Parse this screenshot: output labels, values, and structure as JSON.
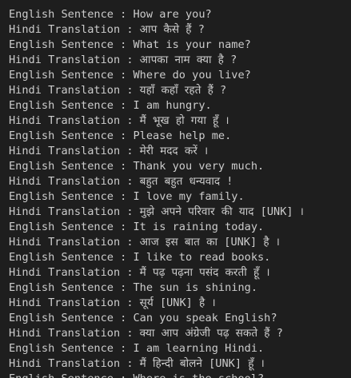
{
  "output": {
    "lines": [
      "English Sentence : How are you?",
      "Hindi Translation : आप कैसे हैं ?",
      "English Sentence : What is your name?",
      "Hindi Translation : आपका नाम क्या है ?",
      "English Sentence : Where do you live?",
      "Hindi Translation : यहाँ कहाँ रहते हैं ?",
      "English Sentence : I am hungry.",
      "Hindi Translation : मैं भूख हो गया हूँ ।",
      "English Sentence : Please help me.",
      "Hindi Translation : मेरी मदद करें ।",
      "English Sentence : Thank you very much.",
      "Hindi Translation : बहुत बहुत धन्यवाद !",
      "English Sentence : I love my family.",
      "Hindi Translation : मुझे अपने परिवार की याद [UNK] ।",
      "English Sentence : It is raining today.",
      "Hindi Translation : आज इस बात का [UNK] है ।",
      "English Sentence : I like to read books.",
      "Hindi Translation : मैं पढ़ पढ़ना पसंद करती हूँ ।",
      "English Sentence : The sun is shining.",
      "Hindi Translation : सूर्य [UNK] है ।",
      "English Sentence : Can you speak English?",
      "Hindi Translation : क्या आप अंग्रेजी पढ़ सकते हैं ?",
      "English Sentence : I am learning Hindi.",
      "Hindi Translation : मैं हिन्दी बोलने [UNK] हूँ ।",
      "English Sentence : Where is the school?"
    ]
  }
}
